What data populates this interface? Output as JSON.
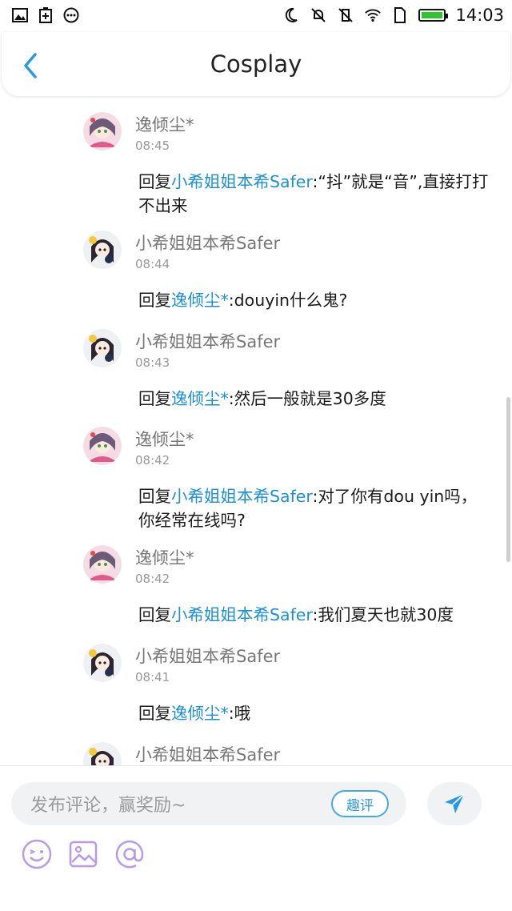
{
  "status_bar": {
    "time": "14:03",
    "left_icons": [
      "image-icon",
      "battery-plus-icon",
      "more-dots-icon"
    ],
    "right_icons": [
      "moon-icon",
      "mute-icon",
      "vibrate-off-icon",
      "wifi-icon",
      "sim-icon",
      "battery-icon"
    ]
  },
  "header": {
    "title": "Cosplay",
    "back_icon": "chevron-left-icon"
  },
  "messages": [
    {
      "user": "逸倾尘*",
      "time": "08:45",
      "avatar": "avatar-girl-pink",
      "reply_prefix": "回复",
      "reply_to": "小希姐姐本希Safer",
      "text": ":“抖”就是“音”,直接打打不出来"
    },
    {
      "user": "小希姐姐本希Safer",
      "time": "08:44",
      "avatar": "avatar-girl-dark",
      "reply_prefix": "回复",
      "reply_to": "逸倾尘*",
      "text": ":douyin什么鬼?"
    },
    {
      "user": "小希姐姐本希Safer",
      "time": "08:43",
      "avatar": "avatar-girl-dark",
      "reply_prefix": "回复",
      "reply_to": "逸倾尘*",
      "text": ":然后一般就是30多度"
    },
    {
      "user": "逸倾尘*",
      "time": "08:42",
      "avatar": "avatar-girl-pink",
      "reply_prefix": "回复",
      "reply_to": "小希姐姐本希Safer",
      "text": ":对了你有dou yin吗，你经常在线吗?"
    },
    {
      "user": "逸倾尘*",
      "time": "08:42",
      "avatar": "avatar-girl-pink",
      "reply_prefix": "回复",
      "reply_to": "小希姐姐本希Safer",
      "text": ":我们夏天也就30度"
    },
    {
      "user": "小希姐姐本希Safer",
      "time": "08:41",
      "avatar": "avatar-girl-dark",
      "reply_prefix": "回复",
      "reply_to": "逸倾尘*",
      "text": ":哦"
    },
    {
      "user": "小希姐姐本希Safer",
      "time": "",
      "avatar": "avatar-girl-dark",
      "reply_prefix": "",
      "reply_to": "",
      "text": ""
    }
  ],
  "composer": {
    "placeholder": "发布评论，赢奖励~",
    "quping_label": "趣评",
    "send_icon": "paper-plane-icon",
    "tools": [
      "emoji-icon",
      "image-icon",
      "at-icon"
    ]
  },
  "colors": {
    "link": "#1d8fd6",
    "accent": "#45a7e6",
    "tool_purple": "#b89be8"
  }
}
